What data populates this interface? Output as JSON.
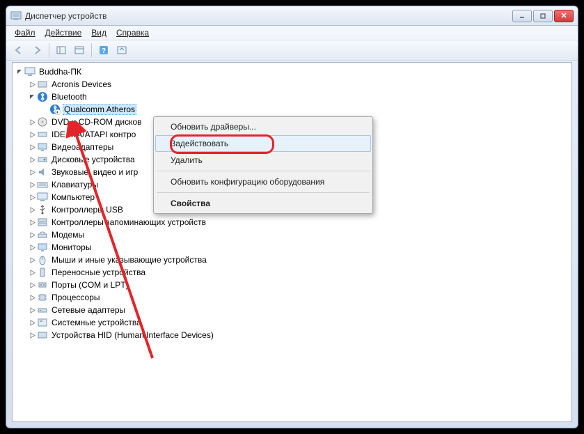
{
  "window": {
    "title": "Диспетчер устройств"
  },
  "menu": {
    "file": "Файл",
    "action": "Действие",
    "view": "Вид",
    "help": "Справка"
  },
  "tree": {
    "root": "Buddha-ПК",
    "acronis": "Acronis Devices",
    "bluetooth": "Bluetooth",
    "bt_device": "Qualcomm Atheros",
    "dvd": "DVD и CD-ROM дисков",
    "ide": "IDE ATA/ATAPI контро",
    "video": "Видеоадаптеры",
    "disk": "Дисковые устройства",
    "sound": "Звуковые, видео и игр",
    "keyboard": "Клавиатуры",
    "computer": "Компьютер",
    "usb": "Контроллеры USB",
    "storage": "Контроллеры запоминающих устройств",
    "modem": "Модемы",
    "monitor": "Мониторы",
    "mouse": "Мыши и иные указывающие устройства",
    "portable": "Переносные устройства",
    "ports": "Порты (COM и LPT)",
    "cpu": "Процессоры",
    "network": "Сетевые адаптеры",
    "system": "Системные устройства",
    "hid": "Устройства HID (Human Interface Devices)"
  },
  "context": {
    "update": "Обновить драйверы...",
    "enable": "Задействовать",
    "delete": "Удалить",
    "scan": "Обновить конфигурацию оборудования",
    "props": "Свойства"
  }
}
